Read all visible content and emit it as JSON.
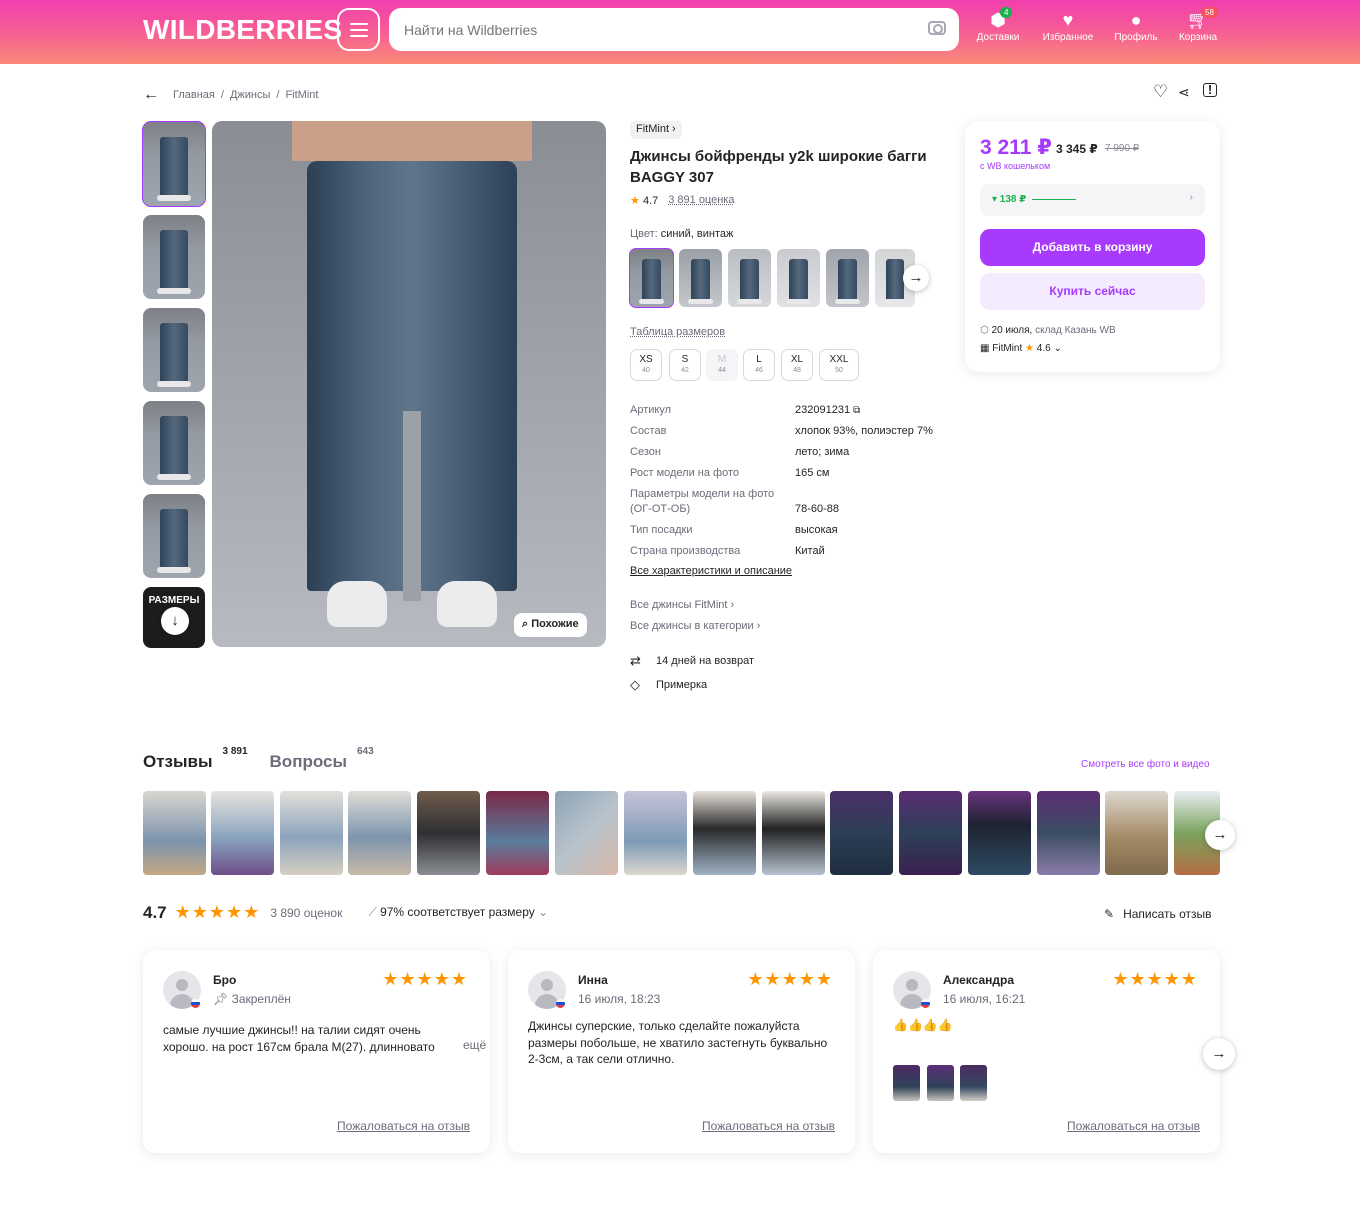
{
  "header": {
    "logo": "WILDBERRIES",
    "search_placeholder": "Найти на Wildberries",
    "icons": [
      {
        "name": "deliveries",
        "label": "Доставки",
        "badge": "4",
        "badge_color": "#1bb04d"
      },
      {
        "name": "favorites",
        "label": "Избранное"
      },
      {
        "name": "profile",
        "label": "Профиль"
      },
      {
        "name": "cart",
        "label": "Корзина",
        "badge": "58",
        "badge_color": "#f5515f"
      }
    ]
  },
  "breadcrumbs": [
    "Главная",
    "Джинсы",
    "FitMint"
  ],
  "product": {
    "brand": "FitMint",
    "title": "Джинсы бойфренды y2k широкие багги BAGGY 307",
    "rating": "4.7",
    "rating_count": "3 891 оценка",
    "color_label": "Цвет:",
    "color_value": "синий, винтаж",
    "similar_button": "Похожие",
    "sizes_table_link": "Таблица размеров",
    "sizes": [
      {
        "label": "XS",
        "ru": "40",
        "available": true
      },
      {
        "label": "S",
        "ru": "42",
        "available": true
      },
      {
        "label": "M",
        "ru": "44",
        "available": false
      },
      {
        "label": "L",
        "ru": "46",
        "available": true
      },
      {
        "label": "XL",
        "ru": "48",
        "available": true
      },
      {
        "label": "XXL",
        "ru": "50",
        "available": true
      }
    ],
    "specs": [
      {
        "k": "Артикул",
        "v": "232091231"
      },
      {
        "k": "Состав",
        "v": "хлопок 93%, полиэстер 7%"
      },
      {
        "k": "Сезон",
        "v": "лето; зима"
      },
      {
        "k": "Рост модели на фото",
        "v": "165 см"
      },
      {
        "k": "Параметры модели на фото (ОГ-ОТ-ОБ)",
        "v": "78-60-88"
      },
      {
        "k": "Тип посадки",
        "v": "высокая"
      },
      {
        "k": "Страна производства",
        "v": "Китай"
      }
    ],
    "all_specs_link": "Все характеристики и описание",
    "brand_link": "Все джинсы FitMint",
    "category_link": "Все джинсы в категории",
    "features": [
      "14 дней на возврат",
      "Примерка"
    ],
    "thumb_sizes_text": "РАЗМЕРЫ"
  },
  "pricing": {
    "price_wallet": "3 211 ₽",
    "price": "3 345 ₽",
    "old_price": "7 990 ₽",
    "wallet_note": "с WB кошельком",
    "bonus": "▾ 138 ₽",
    "add_to_cart": "Добавить в корзину",
    "buy_now": "Купить сейчас",
    "delivery_date": "20 июля,",
    "delivery_place": "склад Казань WB",
    "seller": "FitMint",
    "seller_rating": "4.6"
  },
  "reviews": {
    "tab_reviews": "Отзывы",
    "reviews_count": "3 891",
    "tab_questions": "Вопросы",
    "questions_count": "643",
    "see_all": "Смотреть все фото и видео",
    "overall": "4.7",
    "overall_count": "3 890 оценок",
    "fit": "97% соответствует размеру",
    "write": "Написать отзыв",
    "complain": "Пожаловаться на отзыв",
    "more": "ещё",
    "items": [
      {
        "name": "Бро",
        "meta": "Закреплён",
        "text": "самые лучшие джинсы!! на талии сидят очень хорошо. на рост 167см брала M(27). длинновато"
      },
      {
        "name": "Инна",
        "meta": "16 июля, 18:23",
        "text": "Джинсы суперские, только сделайте пожалуйста размеры побольше, не хватило застегнуть буквально 2-3см, а так сели отлично."
      },
      {
        "name": "Александра",
        "meta": "16 июля, 16:21",
        "text": "👍👍👍👍"
      }
    ]
  },
  "colors": {
    "accent": "#a73afd",
    "rating": "#ff9500",
    "header_start": "#f13fae",
    "header_end": "#f98a78"
  }
}
